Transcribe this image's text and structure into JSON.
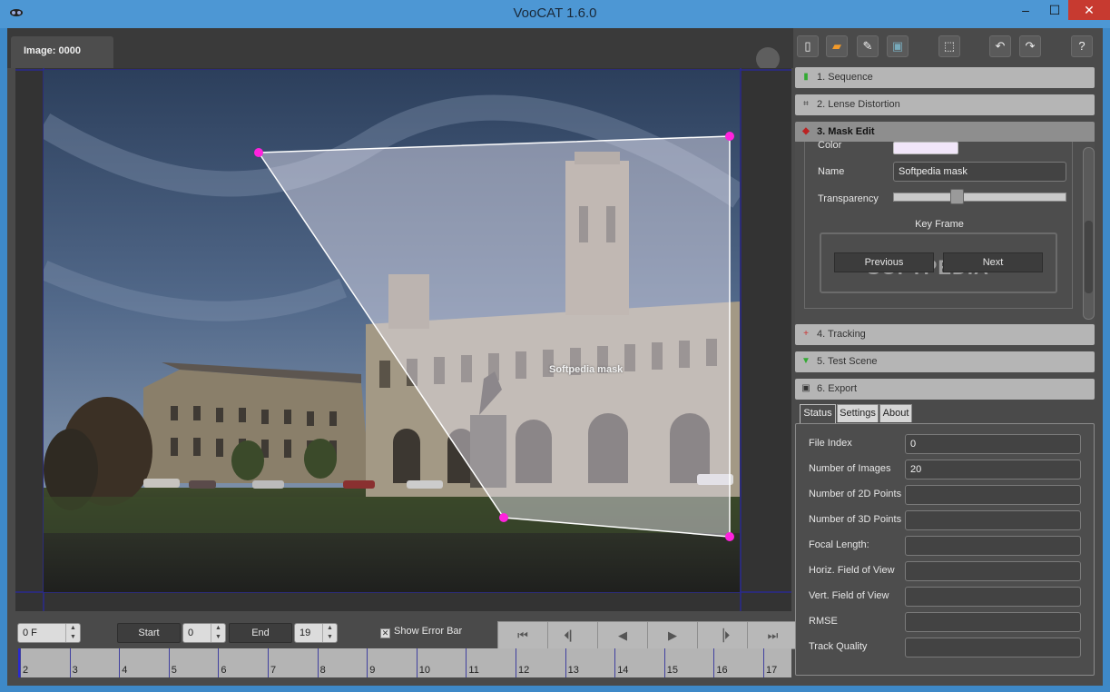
{
  "window": {
    "title": "VooCAT 1.6.0",
    "min_glyph": "–",
    "max_glyph": "☐",
    "close_glyph": "✕"
  },
  "viewer": {
    "image_tab_label": "Image: 0000",
    "mask_label": "Softpedia mask"
  },
  "toolbar": {
    "icons": [
      "new-file-icon",
      "open-folder-icon",
      "edit-icon",
      "save-icon",
      "select-region-icon",
      "undo-icon",
      "redo-icon",
      "help-icon"
    ]
  },
  "sections": [
    {
      "label": "1. Sequence",
      "icon": "film-icon"
    },
    {
      "label": "2. Lense Distortion",
      "icon": "lens-grid-icon"
    },
    {
      "label": "3. Mask Edit",
      "icon": "mask-icon"
    },
    {
      "label": "4. Tracking",
      "icon": "tracking-icon"
    },
    {
      "label": "5. Test Scene",
      "icon": "test-scene-icon"
    },
    {
      "label": "6. Export",
      "icon": "export-icon"
    }
  ],
  "mask_edit": {
    "color_label": "Color",
    "color_value": "#f1e6f9",
    "name_label": "Name",
    "name_value": "Softpedia mask",
    "transparency_label": "Transparency",
    "transparency_fraction": 0.36,
    "keyframe_title": "Key Frame",
    "previous_label": "Previous",
    "next_label": "Next",
    "watermark": "SOFTPEDIA"
  },
  "tabs": [
    {
      "label": "Status",
      "active": true
    },
    {
      "label": "Settings",
      "active": false
    },
    {
      "label": "About",
      "active": false
    }
  ],
  "status_fields": [
    {
      "label": "File Index",
      "value": "0"
    },
    {
      "label": "Number of Images",
      "value": "20"
    },
    {
      "label": "Number of 2D Points",
      "value": ""
    },
    {
      "label": "Number of 3D Points",
      "value": ""
    },
    {
      "label": "Focal Length:",
      "value": ""
    },
    {
      "label": "Horiz. Field of View",
      "value": ""
    },
    {
      "label": "Vert. Field of View",
      "value": ""
    },
    {
      "label": "RMSE",
      "value": ""
    },
    {
      "label": "Track Quality",
      "value": ""
    }
  ],
  "timeline": {
    "frame_value": "0 F",
    "start_label": "Start",
    "start_value": "0",
    "end_label": "End",
    "end_value": "19",
    "show_error_bar_label": "Show Error Bar",
    "show_error_bar_checked": true,
    "transport": [
      "⏮",
      "⏴▏",
      "◀",
      "▶",
      "▕⏵",
      "⏭"
    ],
    "ruler_labels": [
      "2",
      "3",
      "4",
      "5",
      "6",
      "7",
      "8",
      "9",
      "10",
      "11",
      "12",
      "13",
      "14",
      "15",
      "16",
      "17"
    ]
  },
  "colors": {
    "titlebar": "#4d97d4",
    "panel": "#4a4a4a",
    "mask_point": "#ff22dd",
    "ruler_tick": "#4040a0"
  }
}
